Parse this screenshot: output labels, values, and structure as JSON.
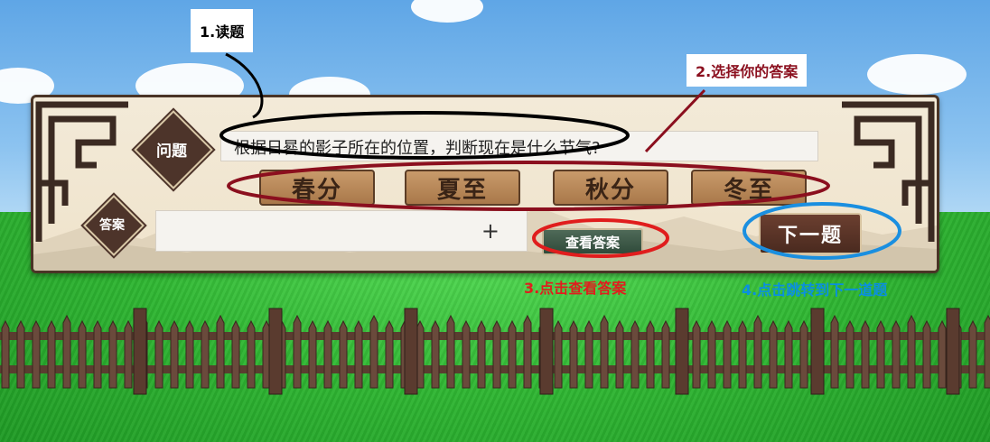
{
  "quiz": {
    "question_label": "问题",
    "question_text": "根据日晷的影子所在的位置，判断现在是什么节气?",
    "options": [
      "春分",
      "夏至",
      "秋分",
      "冬至"
    ],
    "answer_label": "答案",
    "answer_value": "",
    "add_symbol": "+",
    "view_answer_label": "查看答案",
    "next_label": "下一题"
  },
  "annotations": {
    "step1": "1.读题",
    "step2": "2.选择你的答案",
    "step3": "3.点击查看答案",
    "step4": "4.点击跳转到下一道题"
  },
  "colors": {
    "step1_ring": "#000000",
    "step2_ring": "#8b0f1e",
    "step3_ring": "#e01d1d",
    "step4_ring": "#1a8fe0"
  }
}
